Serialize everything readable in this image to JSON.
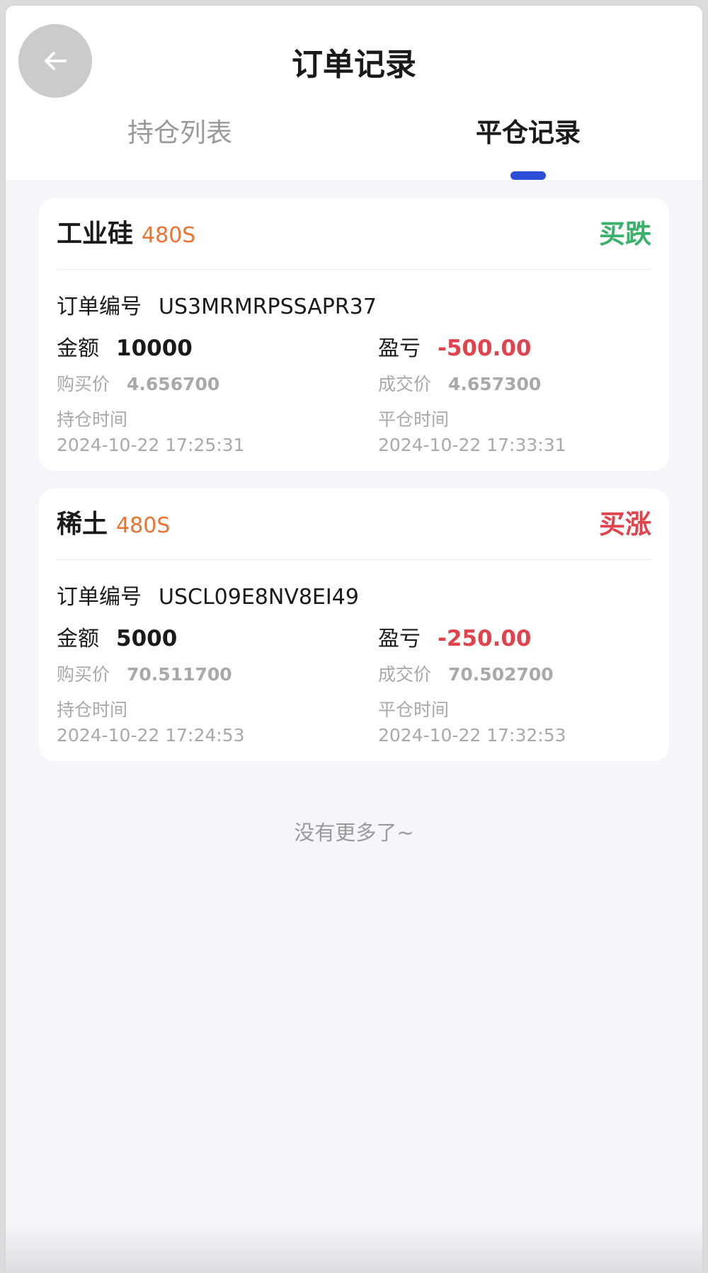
{
  "header": {
    "title": "订单记录"
  },
  "tabs": [
    {
      "label": "持仓列表",
      "active": false
    },
    {
      "label": "平仓记录",
      "active": true
    }
  ],
  "orders": [
    {
      "name": "工业硅",
      "code": "480S",
      "direction": "买跌",
      "order_no_label": "订单编号",
      "order_no": "US3MRMRPSSAPR37",
      "amount_label": "金额",
      "amount": "10000",
      "pnl_label": "盈亏",
      "pnl": "-500.00",
      "buy_price_label": "购买价",
      "buy_price": "4.656700",
      "deal_price_label": "成交价",
      "deal_price": "4.657300",
      "hold_time_label": "持仓时间",
      "hold_time": "2024-10-22 17:25:31",
      "close_time_label": "平仓时间",
      "close_time": "2024-10-22 17:33:31"
    },
    {
      "name": "稀土",
      "code": "480S",
      "direction": "买涨",
      "order_no_label": "订单编号",
      "order_no": "USCL09E8NV8EI49",
      "amount_label": "金额",
      "amount": "5000",
      "pnl_label": "盈亏",
      "pnl": "-250.00",
      "buy_price_label": "购买价",
      "buy_price": "70.511700",
      "deal_price_label": "成交价",
      "deal_price": "70.502700",
      "hold_time_label": "持仓时间",
      "hold_time": "2024-10-22 17:24:53",
      "close_time_label": "平仓时间",
      "close_time": "2024-10-22 17:32:53"
    }
  ],
  "footer": {
    "no_more": "没有更多了~"
  },
  "icons": {
    "back": "arrow-left-icon"
  },
  "colors": {
    "accent": "#2a4fd6",
    "code": "#ee7330",
    "down": "#3bb06a",
    "up": "#e0434c",
    "loss": "#e0434c"
  }
}
